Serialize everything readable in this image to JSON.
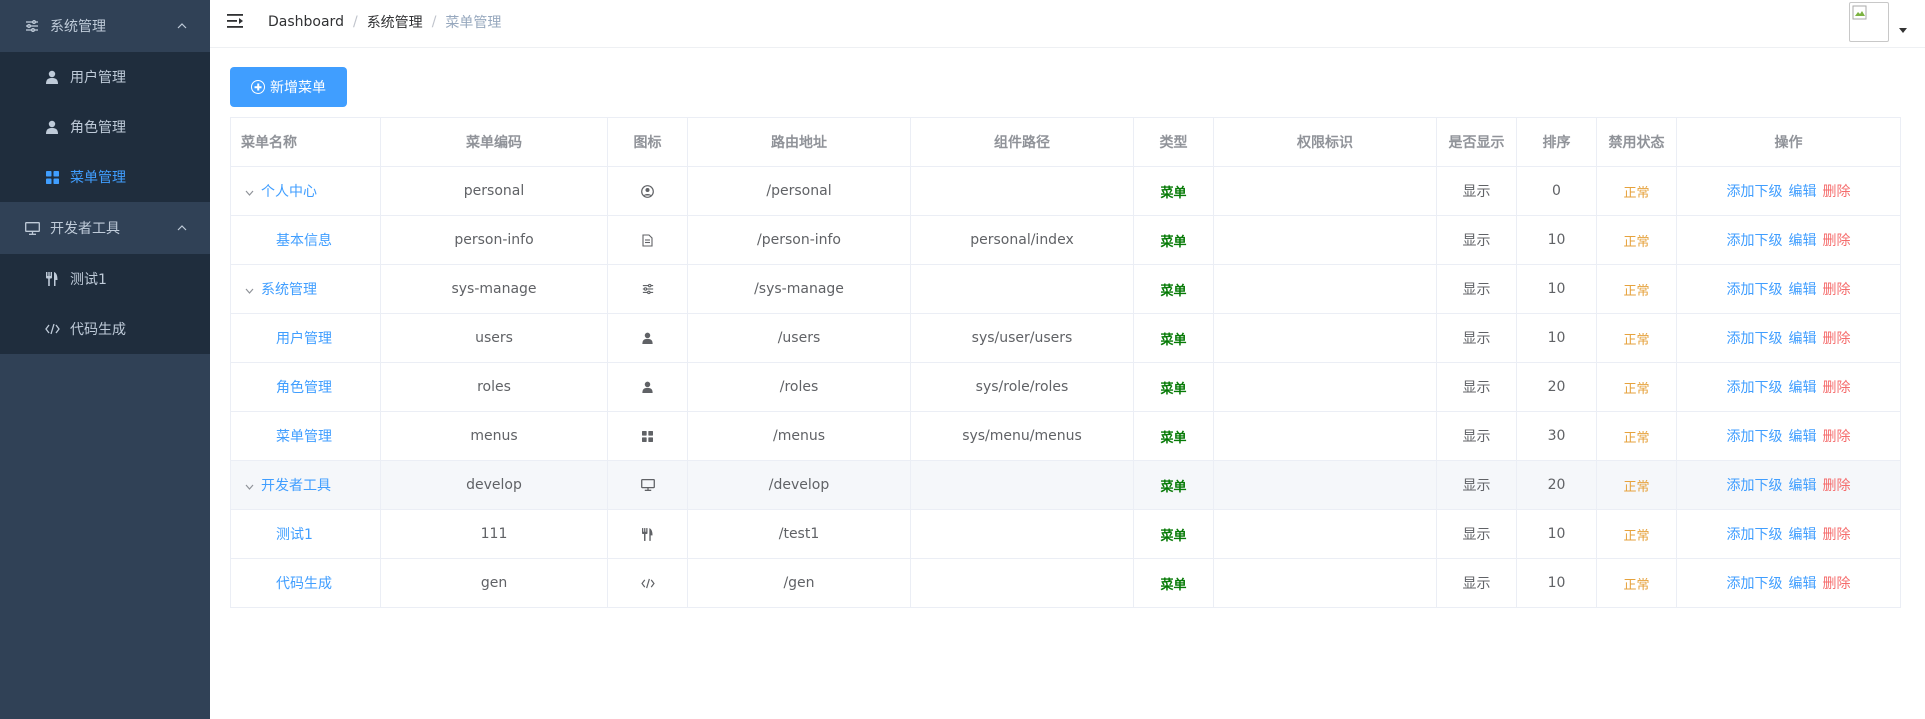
{
  "sidebar": {
    "groups": [
      {
        "title": "系统管理",
        "icon": "sliders-icon",
        "items": [
          {
            "label": "用户管理",
            "icon": "user-icon"
          },
          {
            "label": "角色管理",
            "icon": "user-icon"
          },
          {
            "label": "菜单管理",
            "icon": "grid-icon",
            "active": true
          }
        ]
      },
      {
        "title": "开发者工具",
        "icon": "monitor-icon",
        "items": [
          {
            "label": "测试1",
            "icon": "utensils-icon"
          },
          {
            "label": "代码生成",
            "icon": "code-icon"
          }
        ]
      }
    ]
  },
  "navbar": {
    "breadcrumb": [
      "Dashboard",
      "系统管理",
      "菜单管理"
    ],
    "separator": "/"
  },
  "toolbar": {
    "add_label": "新增菜单"
  },
  "table": {
    "headers": [
      "菜单名称",
      "菜单编码",
      "图标",
      "路由地址",
      "组件路径",
      "类型",
      "权限标识",
      "是否显示",
      "排序",
      "禁用状态",
      "操作"
    ],
    "ops": {
      "add": "添加下级",
      "edit": "编辑",
      "delete": "删除"
    },
    "rows": [
      {
        "name": "个人中心",
        "level": 0,
        "code": "personal",
        "icon": "user-circle-icon",
        "path": "/personal",
        "component": "",
        "type": "菜单",
        "perm": "",
        "show": "显示",
        "order": "0",
        "status": "正常"
      },
      {
        "name": "基本信息",
        "level": 1,
        "code": "person-info",
        "icon": "document-icon",
        "path": "/person-info",
        "component": "personal/index",
        "type": "菜单",
        "perm": "",
        "show": "显示",
        "order": "10",
        "status": "正常"
      },
      {
        "name": "系统管理",
        "level": 0,
        "code": "sys-manage",
        "icon": "sliders-icon",
        "path": "/sys-manage",
        "component": "",
        "type": "菜单",
        "perm": "",
        "show": "显示",
        "order": "10",
        "status": "正常"
      },
      {
        "name": "用户管理",
        "level": 1,
        "code": "users",
        "icon": "user-icon",
        "path": "/users",
        "component": "sys/user/users",
        "type": "菜单",
        "perm": "",
        "show": "显示",
        "order": "10",
        "status": "正常"
      },
      {
        "name": "角色管理",
        "level": 1,
        "code": "roles",
        "icon": "user-icon",
        "path": "/roles",
        "component": "sys/role/roles",
        "type": "菜单",
        "perm": "",
        "show": "显示",
        "order": "20",
        "status": "正常"
      },
      {
        "name": "菜单管理",
        "level": 1,
        "code": "menus",
        "icon": "grid-icon",
        "path": "/menus",
        "component": "sys/menu/menus",
        "type": "菜单",
        "perm": "",
        "show": "显示",
        "order": "30",
        "status": "正常"
      },
      {
        "name": "开发者工具",
        "level": 0,
        "code": "develop",
        "icon": "monitor-icon",
        "path": "/develop",
        "component": "",
        "type": "菜单",
        "perm": "",
        "show": "显示",
        "order": "20",
        "status": "正常",
        "hover": true
      },
      {
        "name": "测试1",
        "level": 1,
        "code": "111",
        "icon": "utensils-icon",
        "path": "/test1",
        "component": "",
        "type": "菜单",
        "perm": "",
        "show": "显示",
        "order": "10",
        "status": "正常"
      },
      {
        "name": "代码生成",
        "level": 1,
        "code": "gen",
        "icon": "code-icon",
        "path": "/gen",
        "component": "",
        "type": "菜单",
        "perm": "",
        "show": "显示",
        "order": "10",
        "status": "正常"
      }
    ]
  }
}
